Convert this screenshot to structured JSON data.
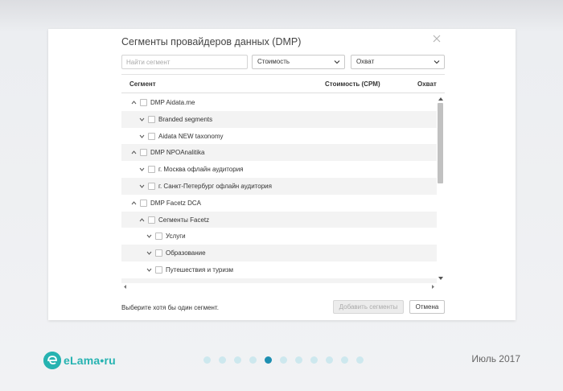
{
  "dialog": {
    "title": "Сегменты провайдеров данных (DMP)",
    "search_placeholder": "Найти сегмент",
    "cost_select": "Стоимость",
    "reach_select": "Охват",
    "columns": {
      "segment": "Сегмент",
      "cost": "Стоимость (CPM)",
      "reach": "Охват"
    },
    "rows": [
      {
        "label": "DMP Aidata.me",
        "caret": "up"
      },
      {
        "label": "Branded segments",
        "caret": "down"
      },
      {
        "label": "Aidata NEW taxonomy",
        "caret": "down"
      },
      {
        "label": "DMP NPOAnalitika",
        "caret": "up"
      },
      {
        "label": "г. Москва офлайн аудитория",
        "caret": "down"
      },
      {
        "label": "г. Санкт-Петербург офлайн аудитория",
        "caret": "down"
      },
      {
        "label": "DMP Facetz DCA",
        "caret": "up"
      },
      {
        "label": "Сегменты Facetz",
        "caret": "up"
      },
      {
        "label": "Услуги",
        "caret": "down"
      },
      {
        "label": "Образование",
        "caret": "down"
      },
      {
        "label": "Путешествия и туризм",
        "caret": "down"
      },
      {
        "label": "",
        "caret": "down"
      }
    ],
    "hint": "Выберите хотя бы один сегмент.",
    "add_button": "Добавить сегменты",
    "cancel_button": "Отмена"
  },
  "footer": {
    "logo_text": "eLama•ru",
    "date": "Июль 2017",
    "pages_total": 11,
    "current_page": 5
  },
  "colors": {
    "brand": "#26b3b1",
    "active_dot": "#1d8fb1",
    "inactive_dot": "#cde8ee"
  }
}
